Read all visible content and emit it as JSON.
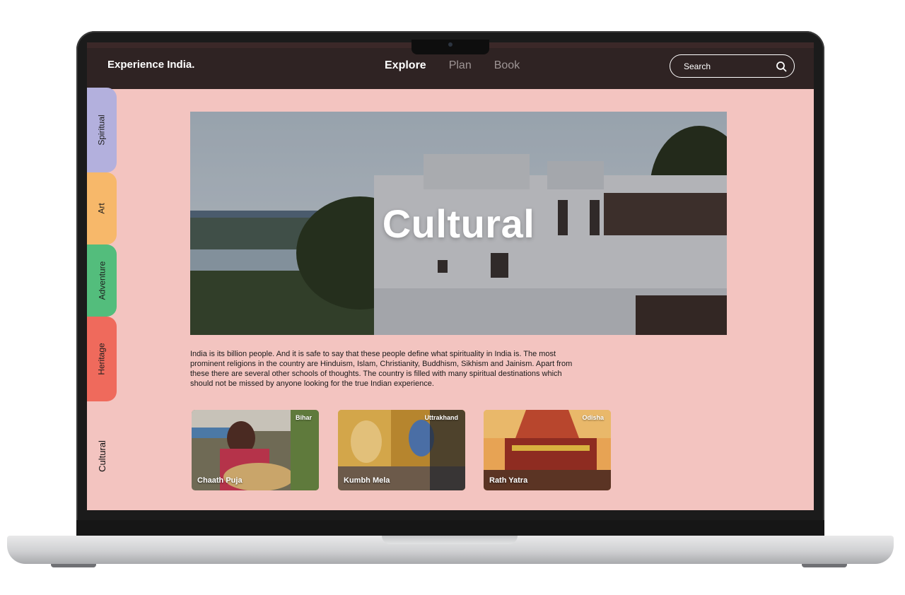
{
  "app": {
    "brand": "Experience India."
  },
  "nav": {
    "items": [
      {
        "label": "Explore",
        "active": true
      },
      {
        "label": "Plan",
        "active": false
      },
      {
        "label": "Book",
        "active": false
      }
    ]
  },
  "search": {
    "label": "Search",
    "icon": "search-icon"
  },
  "sidebar": {
    "tabs": [
      {
        "label": "Spiritual",
        "color": "#b3b0dd"
      },
      {
        "label": "Art",
        "color": "#f7b86a"
      },
      {
        "label": "Adventure",
        "color": "#53bd7c"
      },
      {
        "label": "Heritage",
        "color": "#ef6a5c"
      },
      {
        "label": "Cultural",
        "color": "#f3c4c0",
        "active": true
      }
    ]
  },
  "hero": {
    "title": "Cultural"
  },
  "description": "India is its billion people. And it is safe to say that these people define what spirituality in India is. The most prominent religions in the country are Hinduism, Islam, Christianity, Buddhism, Sikhism and Jainism. Apart from these there are several other schools of thoughts. The country is filled with many spiritual destinations which should not be missed by anyone looking for the true Indian experience.",
  "cards": [
    {
      "name": "Chaath Puja",
      "state": "Bihar"
    },
    {
      "name": "Kumbh Mela",
      "state": "Uttrakhand"
    },
    {
      "name": "Rath Yatra",
      "state": "Odisha"
    }
  ],
  "colors": {
    "screen_bg": "#f3c4c0",
    "header_bg": "#2f2323"
  }
}
